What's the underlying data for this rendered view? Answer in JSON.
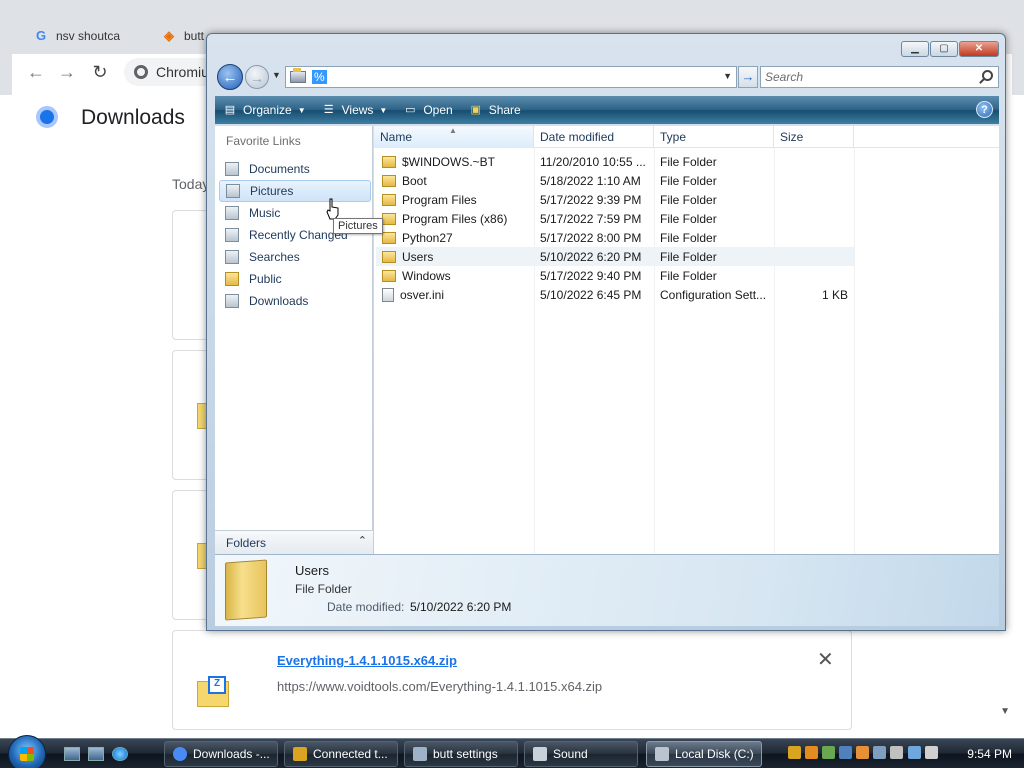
{
  "chrome": {
    "tabs": [
      {
        "label": "nsv shoutca",
        "icon": "google-icon"
      },
      {
        "label": "butt",
        "icon": "butt-icon"
      }
    ],
    "omnibox_text": "Chromiu",
    "page_title": "Downloads",
    "section_label": "Today",
    "download": {
      "name": "Everything-1.4.1.1015.x64.zip",
      "url": "https://www.voidtools.com/Everything-1.4.1.1015.x64.zip",
      "close_glyph": "✕"
    }
  },
  "explorer": {
    "address_text": "%",
    "search_placeholder": "Search",
    "commands": [
      {
        "label": "Organize",
        "icon": "organize-icon",
        "dropdown": true
      },
      {
        "label": "Views",
        "icon": "views-icon",
        "dropdown": true
      },
      {
        "label": "Open",
        "icon": "open-icon",
        "dropdown": false
      },
      {
        "label": "Share",
        "icon": "share-icon",
        "dropdown": false
      }
    ],
    "favorite_links_title": "Favorite Links",
    "favorite_links": [
      {
        "label": "Documents",
        "icon": "documents-icon"
      },
      {
        "label": "Pictures",
        "icon": "pictures-icon",
        "selected": true
      },
      {
        "label": "Music",
        "icon": "music-icon"
      },
      {
        "label": "Recently Changed",
        "icon": "recently-changed-icon"
      },
      {
        "label": "Searches",
        "icon": "searches-icon"
      },
      {
        "label": "Public",
        "icon": "public-folder-icon"
      },
      {
        "label": "Downloads",
        "icon": "downloads-icon"
      }
    ],
    "folders_label": "Folders",
    "columns": {
      "name": "Name",
      "date": "Date modified",
      "type": "Type",
      "size": "Size"
    },
    "files": [
      {
        "name": "$WINDOWS.~BT",
        "date": "11/20/2010 10:55 ...",
        "type": "File Folder",
        "size": "",
        "icon": "folder-icon"
      },
      {
        "name": "Boot",
        "date": "5/18/2022 1:10 AM",
        "type": "File Folder",
        "size": "",
        "icon": "folder-icon"
      },
      {
        "name": "Program Files",
        "date": "5/17/2022 9:39 PM",
        "type": "File Folder",
        "size": "",
        "icon": "folder-icon"
      },
      {
        "name": "Program Files (x86)",
        "date": "5/17/2022 7:59 PM",
        "type": "File Folder",
        "size": "",
        "icon": "folder-icon"
      },
      {
        "name": "Python27",
        "date": "5/17/2022 8:00 PM",
        "type": "File Folder",
        "size": "",
        "icon": "folder-icon"
      },
      {
        "name": "Users",
        "date": "5/10/2022 6:20 PM",
        "type": "File Folder",
        "size": "",
        "icon": "folder-icon",
        "hover": true
      },
      {
        "name": "Windows",
        "date": "5/17/2022 9:40 PM",
        "type": "File Folder",
        "size": "",
        "icon": "folder-icon"
      },
      {
        "name": "osver.ini",
        "date": "5/10/2022 6:45 PM",
        "type": "Configuration Sett...",
        "size": "1 KB",
        "icon": "config-file-icon"
      }
    ],
    "details": {
      "name": "Users",
      "type": "File Folder",
      "modified_label": "Date modified:",
      "modified_value": "5/10/2022 6:20 PM"
    },
    "tooltip": "Pictures"
  },
  "taskbar": {
    "buttons": [
      {
        "label": "Downloads -...",
        "icon": "chromium-icon",
        "active": false
      },
      {
        "label": "Connected t...",
        "icon": "butt-app-icon",
        "active": false
      },
      {
        "label": "butt settings",
        "icon": "settings-window-icon",
        "active": false
      },
      {
        "label": "Sound",
        "icon": "speaker-icon",
        "active": false
      },
      {
        "label": "Local Disk (C:)",
        "icon": "drive-icon",
        "active": true
      }
    ],
    "clock": "9:54 PM"
  },
  "colors": {
    "link_blue": "#1a73e8",
    "command_bar": "#2f6488",
    "folder_yellow": "#e4b945"
  }
}
